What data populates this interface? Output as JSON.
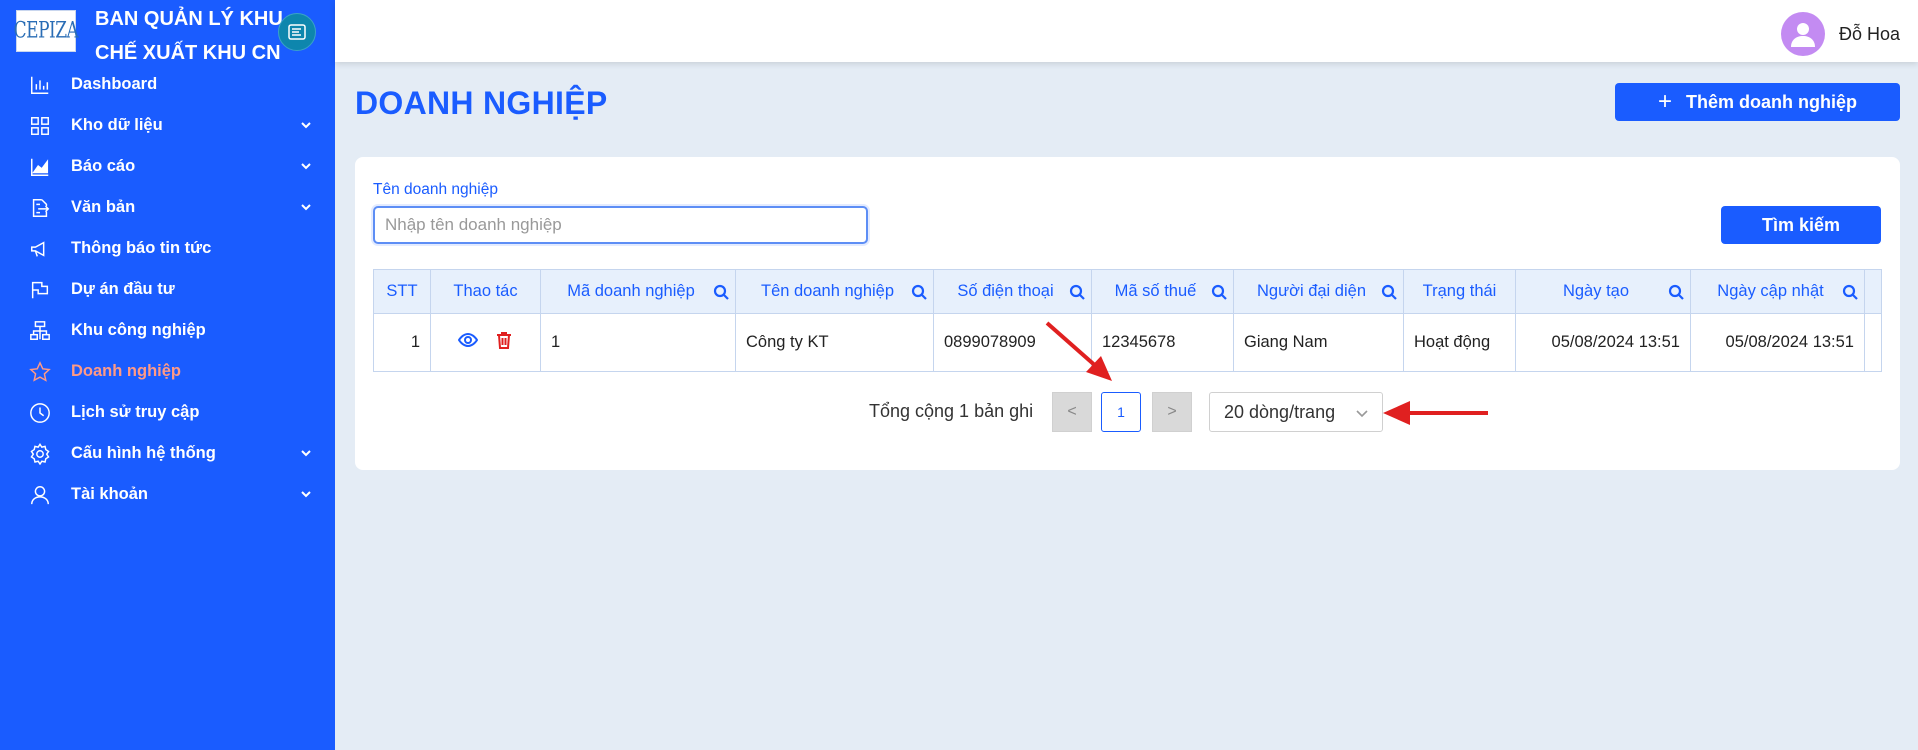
{
  "brand": {
    "logo_text": "CEPIZA",
    "title_line1": "BAN QUẢN LÝ KHU",
    "title_line2": "CHẾ XUẤT KHU CN"
  },
  "sidebar": {
    "items": [
      {
        "label": "Dashboard",
        "icon": "bar-chart-icon",
        "expandable": false,
        "active": false
      },
      {
        "label": "Kho dữ liệu",
        "icon": "grid-icon",
        "expandable": true,
        "active": false
      },
      {
        "label": "Báo cáo",
        "icon": "area-chart-icon",
        "expandable": true,
        "active": false
      },
      {
        "label": "Văn bản",
        "icon": "document-export-icon",
        "expandable": true,
        "active": false
      },
      {
        "label": "Thông báo tin tức",
        "icon": "megaphone-icon",
        "expandable": false,
        "active": false
      },
      {
        "label": "Dự án đầu tư",
        "icon": "flag-icon",
        "expandable": false,
        "active": false
      },
      {
        "label": "Khu công nghiệp",
        "icon": "cluster-icon",
        "expandable": false,
        "active": false
      },
      {
        "label": "Doanh nghiệp",
        "icon": "star-icon",
        "expandable": false,
        "active": true
      },
      {
        "label": "Lịch sử truy cập",
        "icon": "clock-icon",
        "expandable": false,
        "active": false
      },
      {
        "label": "Cấu hình hệ thống",
        "icon": "gear-icon",
        "expandable": true,
        "active": false
      },
      {
        "label": "Tài khoản",
        "icon": "user-icon",
        "expandable": true,
        "active": false
      }
    ]
  },
  "topbar": {
    "username": "Đỗ Hoa"
  },
  "page": {
    "title": "DOANH NGHIỆP",
    "add_button": "Thêm doanh nghiệp"
  },
  "search": {
    "label": "Tên doanh nghiệp",
    "placeholder": "Nhập tên doanh nghiệp",
    "value": "",
    "button": "Tìm kiếm"
  },
  "table": {
    "columns": [
      "STT",
      "Thao tác",
      "Mã doanh nghiệp",
      "Tên doanh nghiệp",
      "Số điện thoại",
      "Mã số thuế",
      "Người đại diện",
      "Trạng thái",
      "Ngày tạo",
      "Ngày cập nhật"
    ],
    "rows": [
      {
        "stt": "1",
        "ma_doanh_nghiep": "1",
        "ten_doanh_nghiep": "Công ty KT",
        "so_dien_thoai": "0899078909",
        "ma_so_thue": "12345678",
        "nguoi_dai_dien": "Giang Nam",
        "trang_thai": "Hoạt động",
        "ngay_tao": "05/08/2024 13:51",
        "ngay_cap_nhat": "05/08/2024 13:51"
      }
    ]
  },
  "pagination": {
    "total_text": "Tổng cộng 1 bản ghi",
    "prev": "<",
    "current_page": "1",
    "next": ">",
    "page_size": "20 dòng/trang"
  },
  "colors": {
    "primary": "#1a5cff",
    "active_menu": "#ff9a86",
    "status_active": "#2f9e2f",
    "annotation_arrow": "#e02020"
  }
}
